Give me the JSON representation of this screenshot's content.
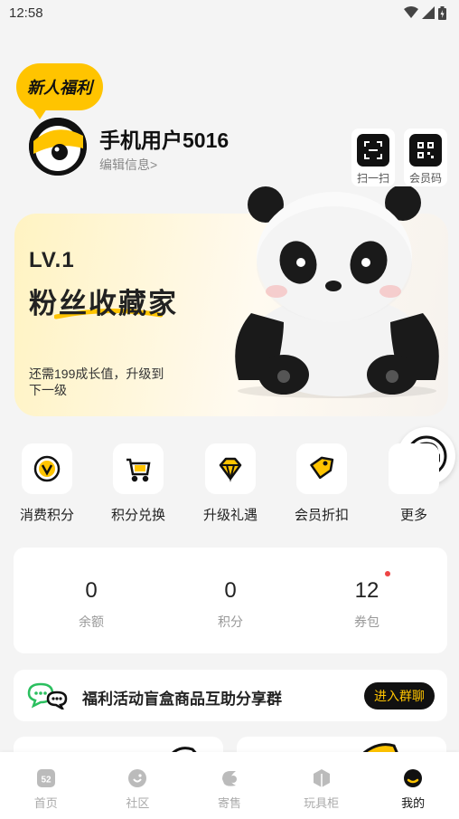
{
  "status_bar": {
    "time": "12:58"
  },
  "profile": {
    "badge": "新人福利",
    "username": "手机用户5016",
    "edit_label": "编辑信息>"
  },
  "quick_actions": [
    {
      "label": "扫一扫",
      "icon": "scan-icon"
    },
    {
      "label": "会员码",
      "icon": "qr-code-icon"
    }
  ],
  "member_card": {
    "level": "LV.1",
    "level_title": "粉丝收藏家",
    "growth_hint": "还需199成长值，升级到下一级"
  },
  "menu": [
    {
      "label": "消费积分",
      "icon": "points-icon"
    },
    {
      "label": "积分兑换",
      "icon": "cart-icon"
    },
    {
      "label": "升级礼遇",
      "icon": "diamond-icon"
    },
    {
      "label": "会员折扣",
      "icon": "tag-icon"
    },
    {
      "label": "更多",
      "icon": "more-icon"
    }
  ],
  "stats": [
    {
      "value": "0",
      "label": "余额"
    },
    {
      "value": "0",
      "label": "积分"
    },
    {
      "value": "12",
      "label": "券包"
    }
  ],
  "group": {
    "text": "福利活动盲盒商品互助分享群",
    "button": "进入群聊"
  },
  "tabs": [
    {
      "label": "首页",
      "icon": "home-icon",
      "active": false
    },
    {
      "label": "社区",
      "icon": "community-icon",
      "active": false
    },
    {
      "label": "寄售",
      "icon": "consign-icon",
      "active": false
    },
    {
      "label": "玩具柜",
      "icon": "toy-cabinet-icon",
      "active": false
    },
    {
      "label": "我的",
      "icon": "profile-icon",
      "active": true
    }
  ],
  "colors": {
    "accent": "#ffc400",
    "dark": "#111111",
    "background": "#f4f4f4"
  }
}
